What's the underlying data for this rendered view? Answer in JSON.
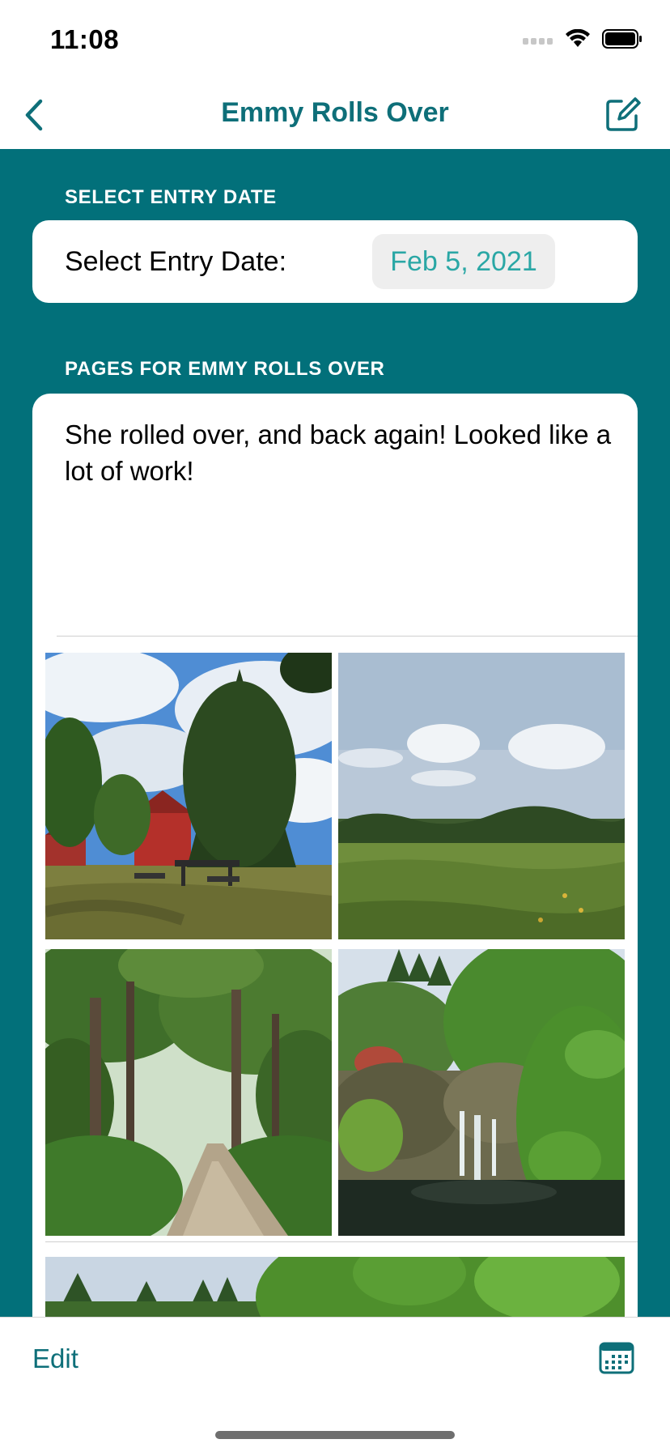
{
  "status_bar": {
    "time": "11:08",
    "icons": [
      "cellular-signal-icon",
      "wifi-icon",
      "battery-icon"
    ]
  },
  "nav": {
    "title": "Emmy Rolls Over",
    "back_icon": "chevron-left-icon",
    "compose_icon": "compose-icon"
  },
  "entry_date_section": {
    "header": "SELECT ENTRY DATE",
    "label": "Select Entry Date:",
    "value": "Feb 5, 2021"
  },
  "pages_section": {
    "header": "PAGES FOR EMMY ROLLS OVER",
    "page_text": "She rolled over, and back again! Looked like a lot of work!",
    "photos": [
      "photo-barn-tree",
      "photo-meadow",
      "photo-forest-path",
      "photo-waterfall-garden",
      "photo-garden-next-page"
    ]
  },
  "toolbar": {
    "edit_label": "Edit",
    "calendar_icon": "calendar-icon"
  },
  "colors": {
    "accent": "#0e6f79",
    "background_teal": "#02707a",
    "date_text": "#2aa7a5",
    "card": "#ffffff"
  }
}
